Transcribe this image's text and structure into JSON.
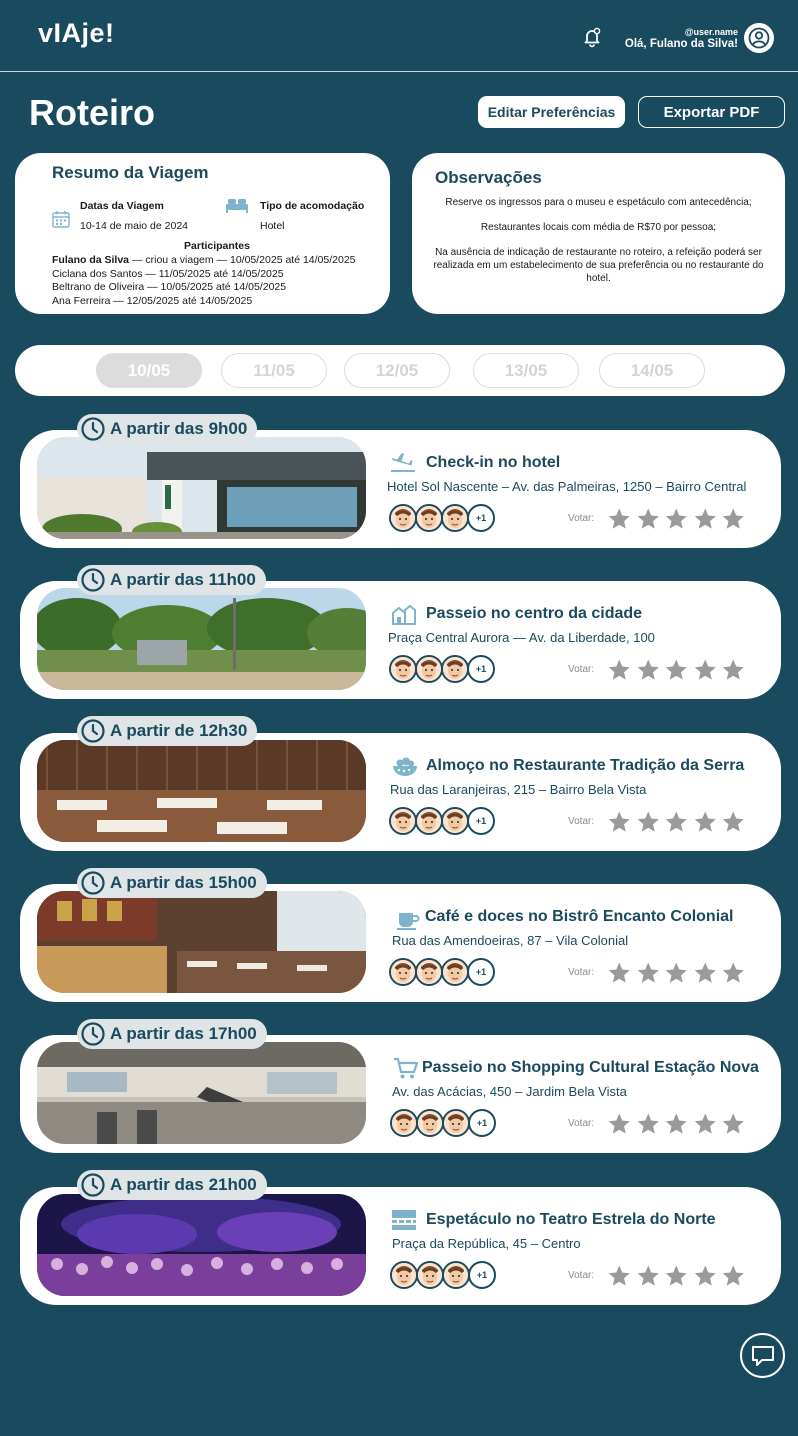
{
  "header": {
    "logo": "vIAje!",
    "username": "@user.name",
    "greeting": "Olá, Fulano da Silva!",
    "bell_icon": "bell-icon",
    "avatar_icon": "user-avatar-icon"
  },
  "page": {
    "title": "Roteiro",
    "edit_pref_label": "Editar Preferências",
    "export_pdf_label": "Exportar PDF"
  },
  "summary": {
    "title": "Resumo da Viagem",
    "dates_label": "Datas da Viagem",
    "dates_value": "10-14 de maio de 2024",
    "accommodation_label": "Tipo de acomodação",
    "accommodation_value": "Hotel",
    "participants_label": "Participantes",
    "participants": [
      {
        "name": "Fulano da Silva",
        "detail": " — criou a viagem — 10/05/2025 até 14/05/2025"
      },
      {
        "name": "",
        "detail": "Ciclana dos Santos — 11/05/2025 até 14/05/2025"
      },
      {
        "name": "",
        "detail": "Beltrano de Oliveira — 10/05/2025 até 14/05/2025"
      },
      {
        "name": "",
        "detail": "Ana Ferreira — 12/05/2025 até 14/05/2025"
      }
    ]
  },
  "observations": {
    "title": "Observações",
    "notes": [
      "Reserve os ingressos para o museu e espetáculo com antecedência;",
      "Restaurantes locais com média de R$70 por pessoa;",
      "Na ausência de indicação de restaurante no roteiro, a refeição poderá ser realizada em um estabelecimento de sua preferência ou no restaurante do hotel."
    ]
  },
  "dates": [
    "10/05",
    "11/05",
    "12/05",
    "13/05",
    "14/05"
  ],
  "selected_date": "10/05",
  "vote_label": "Votar:",
  "more_label": "+1",
  "events": [
    {
      "time": "A partir das 9h00",
      "title": "Check-in no hotel",
      "address": "Hotel Sol Nascente – Av. das Palmeiras, 1250 – Bairro Central",
      "icon": "airplane-landing-icon",
      "image": "hotel-photo"
    },
    {
      "time": "A partir das 11h00",
      "title": "Passeio no centro da cidade",
      "address": "Praça Central Aurora — Av. da Liberdade, 100",
      "icon": "city-buildings-icon",
      "image": "park-photo"
    },
    {
      "time": "A partir de 12h30",
      "title": "Almoço no Restaurante Tradição da Serra",
      "address": "Rua das Laranjeiras, 215 – Bairro Bela Vista",
      "icon": "food-bowl-icon",
      "image": "restaurant-photo"
    },
    {
      "time": "A partir das 15h00",
      "title": "Café e doces no Bistrô Encanto Colonial",
      "address": "Rua das Amendoeiras, 87 – Vila Colonial",
      "icon": "coffee-cup-icon",
      "image": "bistro-photo"
    },
    {
      "time": "A partir das 17h00",
      "title": "Passeio no Shopping Cultural Estação Nova",
      "address": "Av. das Acácias, 450 – Jardim Bela Vista",
      "icon": "shopping-cart-icon",
      "image": "mall-photo"
    },
    {
      "time": "A partir das 21h00",
      "title": "Espetáculo no Teatro  Estrela do Norte",
      "address": "Praça da República, 45 – Centro",
      "icon": "theater-stage-icon",
      "image": "theater-photo"
    }
  ],
  "colors": {
    "brand": "#1a4a5e",
    "star": "#9a9a9a",
    "badge": "#dfe4e7"
  }
}
